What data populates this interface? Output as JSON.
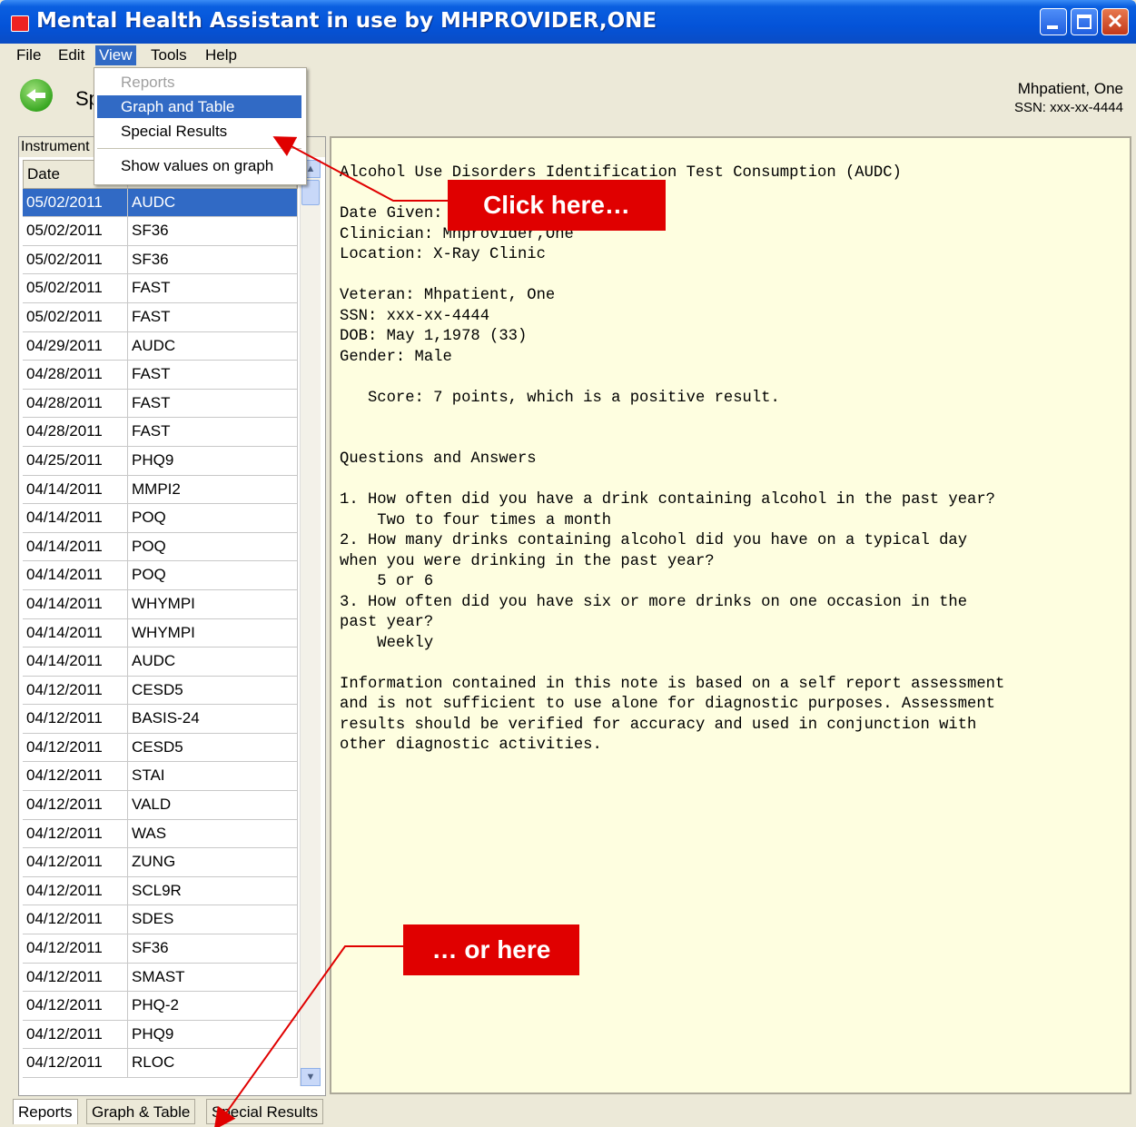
{
  "window": {
    "title": "Mental Health Assistant in use by MHPROVIDER,ONE"
  },
  "menu": {
    "file": "File",
    "edit": "Edit",
    "view": "View",
    "tools": "Tools",
    "help": "Help"
  },
  "view_menu": {
    "reports": "Reports",
    "graph_table": "Graph and Table",
    "special_results": "Special Results",
    "show_values": "Show values on graph"
  },
  "toolbar": {
    "title_fragment": "Sp"
  },
  "patient": {
    "name": "Mhpatient, One",
    "ssn": "SSN: xxx-xx-4444"
  },
  "instrument_panel": {
    "header": "Instrument",
    "columns": [
      "Date",
      ""
    ],
    "rows": [
      [
        "05/02/2011",
        "AUDC"
      ],
      [
        "05/02/2011",
        "SF36"
      ],
      [
        "05/02/2011",
        "SF36"
      ],
      [
        "05/02/2011",
        "FAST"
      ],
      [
        "05/02/2011",
        "FAST"
      ],
      [
        "04/29/2011",
        "AUDC"
      ],
      [
        "04/28/2011",
        "FAST"
      ],
      [
        "04/28/2011",
        "FAST"
      ],
      [
        "04/28/2011",
        "FAST"
      ],
      [
        "04/25/2011",
        "PHQ9"
      ],
      [
        "04/14/2011",
        "MMPI2"
      ],
      [
        "04/14/2011",
        "POQ"
      ],
      [
        "04/14/2011",
        "POQ"
      ],
      [
        "04/14/2011",
        "POQ"
      ],
      [
        "04/14/2011",
        "WHYMPI"
      ],
      [
        "04/14/2011",
        "WHYMPI"
      ],
      [
        "04/14/2011",
        "AUDC"
      ],
      [
        "04/12/2011",
        "CESD5"
      ],
      [
        "04/12/2011",
        "BASIS-24"
      ],
      [
        "04/12/2011",
        "CESD5"
      ],
      [
        "04/12/2011",
        "STAI"
      ],
      [
        "04/12/2011",
        "VALD"
      ],
      [
        "04/12/2011",
        "WAS"
      ],
      [
        "04/12/2011",
        "ZUNG"
      ],
      [
        "04/12/2011",
        "SCL9R"
      ],
      [
        "04/12/2011",
        "SDES"
      ],
      [
        "04/12/2011",
        "SF36"
      ],
      [
        "04/12/2011",
        "SMAST"
      ],
      [
        "04/12/2011",
        "PHQ-2"
      ],
      [
        "04/12/2011",
        "PHQ9"
      ],
      [
        "04/12/2011",
        "RLOC"
      ]
    ]
  },
  "report": {
    "text": "Alcohol Use Disorders Identification Test Consumption (AUDC)\n\nDate Given: 05/02/2011\nClinician: Mhprovider,One\nLocation: X-Ray Clinic\n\nVeteran: Mhpatient, One\nSSN: xxx-xx-4444\nDOB: May 1,1978 (33)\nGender: Male\n\n   Score: 7 points, which is a positive result.\n\n\nQuestions and Answers\n\n1. How often did you have a drink containing alcohol in the past year?\n    Two to four times a month\n2. How many drinks containing alcohol did you have on a typical day\nwhen you were drinking in the past year?\n    5 or 6\n3. How often did you have six or more drinks on one occasion in the\npast year?\n    Weekly\n\nInformation contained in this note is based on a self report assessment\nand is not sufficient to use alone for diagnostic purposes. Assessment\nresults should be verified for accuracy and used in conjunction with\nother diagnostic activities."
  },
  "tabs": {
    "reports": "Reports",
    "graph_table": "Graph & Table",
    "special_results": "Special Results"
  },
  "callouts": {
    "first": "Click here…",
    "second": "… or here"
  },
  "colors": {
    "title_bar": "#0453d8",
    "selection": "#316ac5",
    "callout": "#e00000",
    "report_bg": "#fefee0"
  },
  "icons": {
    "back": "back-arrow-icon",
    "app": "app-icon"
  }
}
